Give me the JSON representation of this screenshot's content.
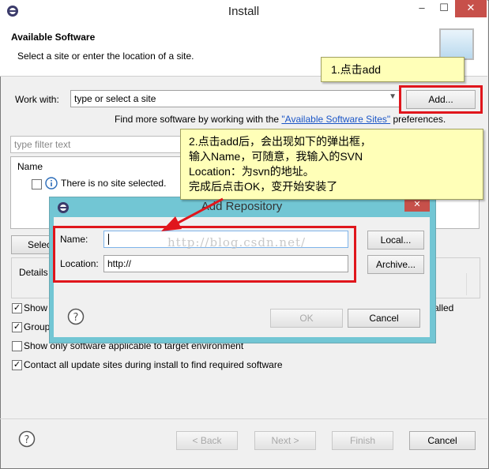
{
  "window": {
    "title": "Install",
    "min": "–",
    "max": "☐",
    "close": "✕"
  },
  "header": {
    "title": "Available Software",
    "subtitle": "Select a site or enter the location of a site."
  },
  "work_with": {
    "label": "Work with:",
    "placeholder": "type or select a site",
    "add_button": "Add...",
    "find_more_prefix": "Find more software by working with the ",
    "link_text": "\"Available Software Sites\"",
    "find_more_suffix": " preferences."
  },
  "filter": {
    "placeholder": "type filter text"
  },
  "table": {
    "column": "Name",
    "empty_message": "There is no site selected."
  },
  "select_button": "Selec",
  "details_label": "Details",
  "options": [
    {
      "label": "Show",
      "checked": true
    },
    {
      "label": "Group",
      "checked": true
    },
    {
      "label": "Show only software applicable to target environment",
      "checked": false
    },
    {
      "label": "Contact all update sites during install to find required software",
      "checked": true
    }
  ],
  "alled_fragment": "alled",
  "footer": {
    "back": "< Back",
    "next": "Next >",
    "finish": "Finish",
    "cancel": "Cancel"
  },
  "dialog": {
    "title": "Add Repository",
    "name_label": "Name:",
    "name_value": "",
    "location_label": "Location:",
    "location_value": "http://",
    "local_button": "Local...",
    "archive_button": "Archive...",
    "ok": "OK",
    "cancel": "Cancel",
    "close": "✕"
  },
  "annotations": {
    "note1": "1.点击add",
    "note2_lines": [
      "2.点击add后，会出现如下的弹出框，",
      "输入Name，可随意，我输入的SVN",
      "Location：为svn的地址。",
      "完成后点击OK，变开始安装了"
    ],
    "watermark": "http://blog.csdn.net/"
  },
  "colors": {
    "annotation_red": "#e0161c",
    "note_yellow": "#ffffb8",
    "dialog_frame": "#72c6d4"
  }
}
